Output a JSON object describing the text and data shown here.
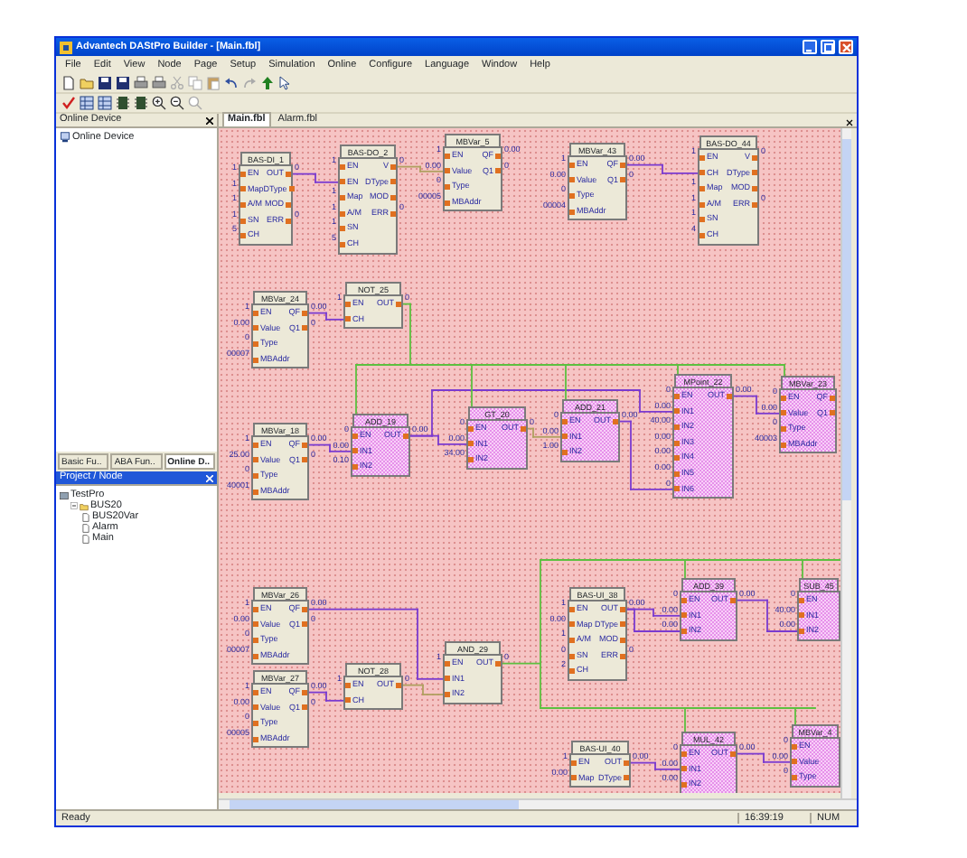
{
  "window": {
    "title": "Advantech DAStPro Builder - [Main.fbl]"
  },
  "menu": [
    "File",
    "Edit",
    "View",
    "Node",
    "Page",
    "Setup",
    "Simulation",
    "Online",
    "Configure",
    "Language",
    "Window",
    "Help"
  ],
  "online_device": {
    "title": "Online Device",
    "items": [
      "Online Device"
    ]
  },
  "panel_tabs": [
    {
      "label": "Basic Fu..",
      "selected": false
    },
    {
      "label": "ABA Fun..",
      "selected": false
    },
    {
      "label": "Online D..",
      "selected": true
    }
  ],
  "project": {
    "title": "Project / Node",
    "tree": [
      {
        "label": "TestPro",
        "children": [
          {
            "label": "BUS20",
            "expanded": true,
            "children": [
              {
                "label": "BUS20Var"
              },
              {
                "label": "Alarm"
              },
              {
                "label": "Main"
              }
            ]
          }
        ]
      }
    ]
  },
  "doc_tabs": [
    {
      "label": "Main.fbl",
      "selected": true
    },
    {
      "label": "Alarm.fbl",
      "selected": false
    }
  ],
  "blocks": [
    {
      "title": "BAS-DI_1",
      "highlighted": false,
      "inputs": [
        {
          "pin": "EN",
          "value": "1"
        },
        {
          "pin": "Map",
          "value": "1"
        },
        {
          "pin": "A/M",
          "value": "1"
        },
        {
          "pin": "SN",
          "value": "1"
        },
        {
          "pin": "CH",
          "value": "5"
        }
      ],
      "outputs": [
        {
          "pin": "OUT",
          "value": "0"
        },
        {
          "pin": "DType"
        },
        {
          "pin": "MOD"
        },
        {
          "pin": "ERR",
          "value": "0"
        }
      ]
    },
    {
      "title": "BAS-DO_2",
      "highlighted": false,
      "inputs": [
        {
          "pin": "EN",
          "value": "1"
        },
        {
          "pin": "EN"
        },
        {
          "pin": "Map",
          "value": "1"
        },
        {
          "pin": "A/M",
          "value": "1"
        },
        {
          "pin": "SN",
          "value": "1"
        },
        {
          "pin": "CH",
          "value": "5"
        }
      ],
      "outputs": [
        {
          "pin": "V",
          "value": "0"
        },
        {
          "pin": "DType"
        },
        {
          "pin": "MOD"
        },
        {
          "pin": "ERR",
          "value": "0"
        }
      ]
    },
    {
      "title": "MBVar_5",
      "highlighted": false,
      "inputs": [
        {
          "pin": "EN",
          "value": "1"
        },
        {
          "pin": "Value",
          "value": "0.00"
        },
        {
          "pin": "Type",
          "value": "0"
        },
        {
          "pin": "MBAddr",
          "value": "00005"
        }
      ],
      "outputs": [
        {
          "pin": "QF",
          "value": "0.00"
        },
        {
          "pin": "Q1",
          "value": "0"
        }
      ]
    },
    {
      "title": "MBVar_43",
      "highlighted": false,
      "inputs": [
        {
          "pin": "EN",
          "value": "1"
        },
        {
          "pin": "Value",
          "value": "0.00"
        },
        {
          "pin": "Type",
          "value": "0"
        },
        {
          "pin": "MBAddr",
          "value": "00004"
        }
      ],
      "outputs": [
        {
          "pin": "QF",
          "value": "0.00"
        },
        {
          "pin": "Q1",
          "value": "0"
        }
      ]
    },
    {
      "title": "BAS-DO_44",
      "highlighted": false,
      "inputs": [
        {
          "pin": "EN",
          "value": "1"
        },
        {
          "pin": "CH"
        },
        {
          "pin": "Map",
          "value": "1"
        },
        {
          "pin": "A/M",
          "value": "1"
        },
        {
          "pin": "SN",
          "value": "1"
        },
        {
          "pin": "CH",
          "value": "4"
        }
      ],
      "outputs": [
        {
          "pin": "V",
          "value": "0"
        },
        {
          "pin": "DType"
        },
        {
          "pin": "MOD"
        },
        {
          "pin": "ERR",
          "value": "0"
        }
      ]
    },
    {
      "title": "MBVar_24",
      "highlighted": false,
      "inputs": [
        {
          "pin": "EN",
          "value": "1"
        },
        {
          "pin": "Value",
          "value": "0.00"
        },
        {
          "pin": "Type",
          "value": "0"
        },
        {
          "pin": "MBAddr",
          "value": "00007"
        }
      ],
      "outputs": [
        {
          "pin": "QF",
          "value": "0.00"
        },
        {
          "pin": "Q1",
          "value": "0"
        }
      ]
    },
    {
      "title": "NOT_25",
      "highlighted": false,
      "inputs": [
        {
          "pin": "EN",
          "value": "1"
        },
        {
          "pin": "CH"
        }
      ],
      "outputs": [
        {
          "pin": "OUT",
          "value": "0"
        }
      ]
    },
    {
      "title": "MBVar_18",
      "highlighted": false,
      "inputs": [
        {
          "pin": "EN",
          "value": "1"
        },
        {
          "pin": "Value",
          "value": "25.00"
        },
        {
          "pin": "Type",
          "value": "0"
        },
        {
          "pin": "MBAddr",
          "value": "40001"
        }
      ],
      "outputs": [
        {
          "pin": "QF",
          "value": "0.00"
        },
        {
          "pin": "Q1",
          "value": "0"
        }
      ]
    },
    {
      "title": "ADD_19",
      "highlighted": true,
      "inputs": [
        {
          "pin": "EN",
          "value": "0"
        },
        {
          "pin": "IN1",
          "value": "0.00"
        },
        {
          "pin": "IN2",
          "value": "0.10"
        }
      ],
      "outputs": [
        {
          "pin": "OUT",
          "value": "0.00"
        }
      ]
    },
    {
      "title": "GT_20",
      "highlighted": true,
      "inputs": [
        {
          "pin": "EN",
          "value": "0"
        },
        {
          "pin": "IN1",
          "value": "0.00"
        },
        {
          "pin": "IN2",
          "value": "34.00"
        }
      ],
      "outputs": [
        {
          "pin": "OUT",
          "value": "0"
        }
      ]
    },
    {
      "title": "ADD_21",
      "highlighted": true,
      "inputs": [
        {
          "pin": "EN",
          "value": "0"
        },
        {
          "pin": "IN1",
          "value": "0.00"
        },
        {
          "pin": "IN2",
          "value": "1.00"
        }
      ],
      "outputs": [
        {
          "pin": "OUT",
          "value": "0.00"
        }
      ]
    },
    {
      "title": "MPoint_22",
      "highlighted": true,
      "inputs": [
        {
          "pin": "EN",
          "value": "0"
        },
        {
          "pin": "IN1",
          "value": "0.00"
        },
        {
          "pin": "IN2",
          "value": "40.00"
        },
        {
          "pin": "IN3",
          "value": "0.00"
        },
        {
          "pin": "IN4",
          "value": "0.00"
        },
        {
          "pin": "IN5",
          "value": "0.00"
        },
        {
          "pin": "IN6",
          "value": "0"
        }
      ],
      "outputs": [
        {
          "pin": "OUT",
          "value": "0.00"
        }
      ]
    },
    {
      "title": "MBVar_23",
      "highlighted": true,
      "inputs": [
        {
          "pin": "EN",
          "value": "0"
        },
        {
          "pin": "Value",
          "value": "0.00"
        },
        {
          "pin": "Type",
          "value": "0"
        },
        {
          "pin": "MBAddr",
          "value": "40003"
        }
      ],
      "outputs": [
        {
          "pin": "QF"
        },
        {
          "pin": "Q1"
        }
      ]
    },
    {
      "title": "MBVar_26",
      "highlighted": false,
      "inputs": [
        {
          "pin": "EN",
          "value": "1"
        },
        {
          "pin": "Value",
          "value": "0.00"
        },
        {
          "pin": "Type",
          "value": "0"
        },
        {
          "pin": "MBAddr",
          "value": "00007"
        }
      ],
      "outputs": [
        {
          "pin": "QF",
          "value": "0.00"
        },
        {
          "pin": "Q1",
          "value": "0"
        }
      ]
    },
    {
      "title": "MBVar_27",
      "highlighted": false,
      "inputs": [
        {
          "pin": "EN",
          "value": "1"
        },
        {
          "pin": "Value",
          "value": "0.00"
        },
        {
          "pin": "Type",
          "value": "0"
        },
        {
          "pin": "MBAddr",
          "value": "00005"
        }
      ],
      "outputs": [
        {
          "pin": "QF",
          "value": "0.00"
        },
        {
          "pin": "Q1",
          "value": "0"
        }
      ]
    },
    {
      "title": "NOT_28",
      "highlighted": false,
      "inputs": [
        {
          "pin": "EN",
          "value": "1"
        },
        {
          "pin": "CH"
        }
      ],
      "outputs": [
        {
          "pin": "OUT",
          "value": "0"
        }
      ]
    },
    {
      "title": "AND_29",
      "highlighted": false,
      "inputs": [
        {
          "pin": "EN",
          "value": "1"
        },
        {
          "pin": "IN1"
        },
        {
          "pin": "IN2"
        }
      ],
      "outputs": [
        {
          "pin": "OUT",
          "value": "0"
        }
      ]
    },
    {
      "title": "BAS-UI_38",
      "highlighted": false,
      "inputs": [
        {
          "pin": "EN",
          "value": "1"
        },
        {
          "pin": "Map",
          "value": "0.00"
        },
        {
          "pin": "A/M",
          "value": "1"
        },
        {
          "pin": "SN",
          "value": "0"
        },
        {
          "pin": "CH",
          "value": "2"
        }
      ],
      "outputs": [
        {
          "pin": "OUT",
          "value": "0.00"
        },
        {
          "pin": "DType"
        },
        {
          "pin": "MOD"
        },
        {
          "pin": "ERR",
          "value": "0"
        }
      ]
    },
    {
      "title": "ADD_39",
      "highlighted": true,
      "inputs": [
        {
          "pin": "EN",
          "value": "0"
        },
        {
          "pin": "IN1",
          "value": "0.00"
        },
        {
          "pin": "IN2",
          "value": "0.00"
        }
      ],
      "outputs": [
        {
          "pin": "OUT",
          "value": "0.00"
        }
      ]
    },
    {
      "title": "SUB_45",
      "highlighted": true,
      "inputs": [
        {
          "pin": "EN",
          "value": "0"
        },
        {
          "pin": "IN1",
          "value": "40.00"
        },
        {
          "pin": "IN2",
          "value": "0.00"
        }
      ]
    },
    {
      "title": "BAS-UI_40",
      "highlighted": false,
      "inputs": [
        {
          "pin": "EN",
          "value": "1"
        },
        {
          "pin": "Map",
          "value": "0.00"
        }
      ],
      "outputs": [
        {
          "pin": "OUT",
          "value": "0.00"
        },
        {
          "pin": "DType"
        }
      ]
    },
    {
      "title": "MUL_42",
      "highlighted": true,
      "inputs": [
        {
          "pin": "EN",
          "value": "0"
        },
        {
          "pin": "IN1",
          "value": "0.00"
        },
        {
          "pin": "IN2",
          "value": "0.00"
        }
      ],
      "outputs": [
        {
          "pin": "OUT",
          "value": "0.00"
        }
      ]
    },
    {
      "title": "MBVar_4",
      "highlighted": true,
      "inputs": [
        {
          "pin": "EN",
          "value": "0"
        },
        {
          "pin": "Value",
          "value": "0.00"
        },
        {
          "pin": "Type",
          "value": "0"
        }
      ]
    }
  ],
  "status_bar": [
    "Ready",
    "16:39:19",
    "NUM"
  ]
}
